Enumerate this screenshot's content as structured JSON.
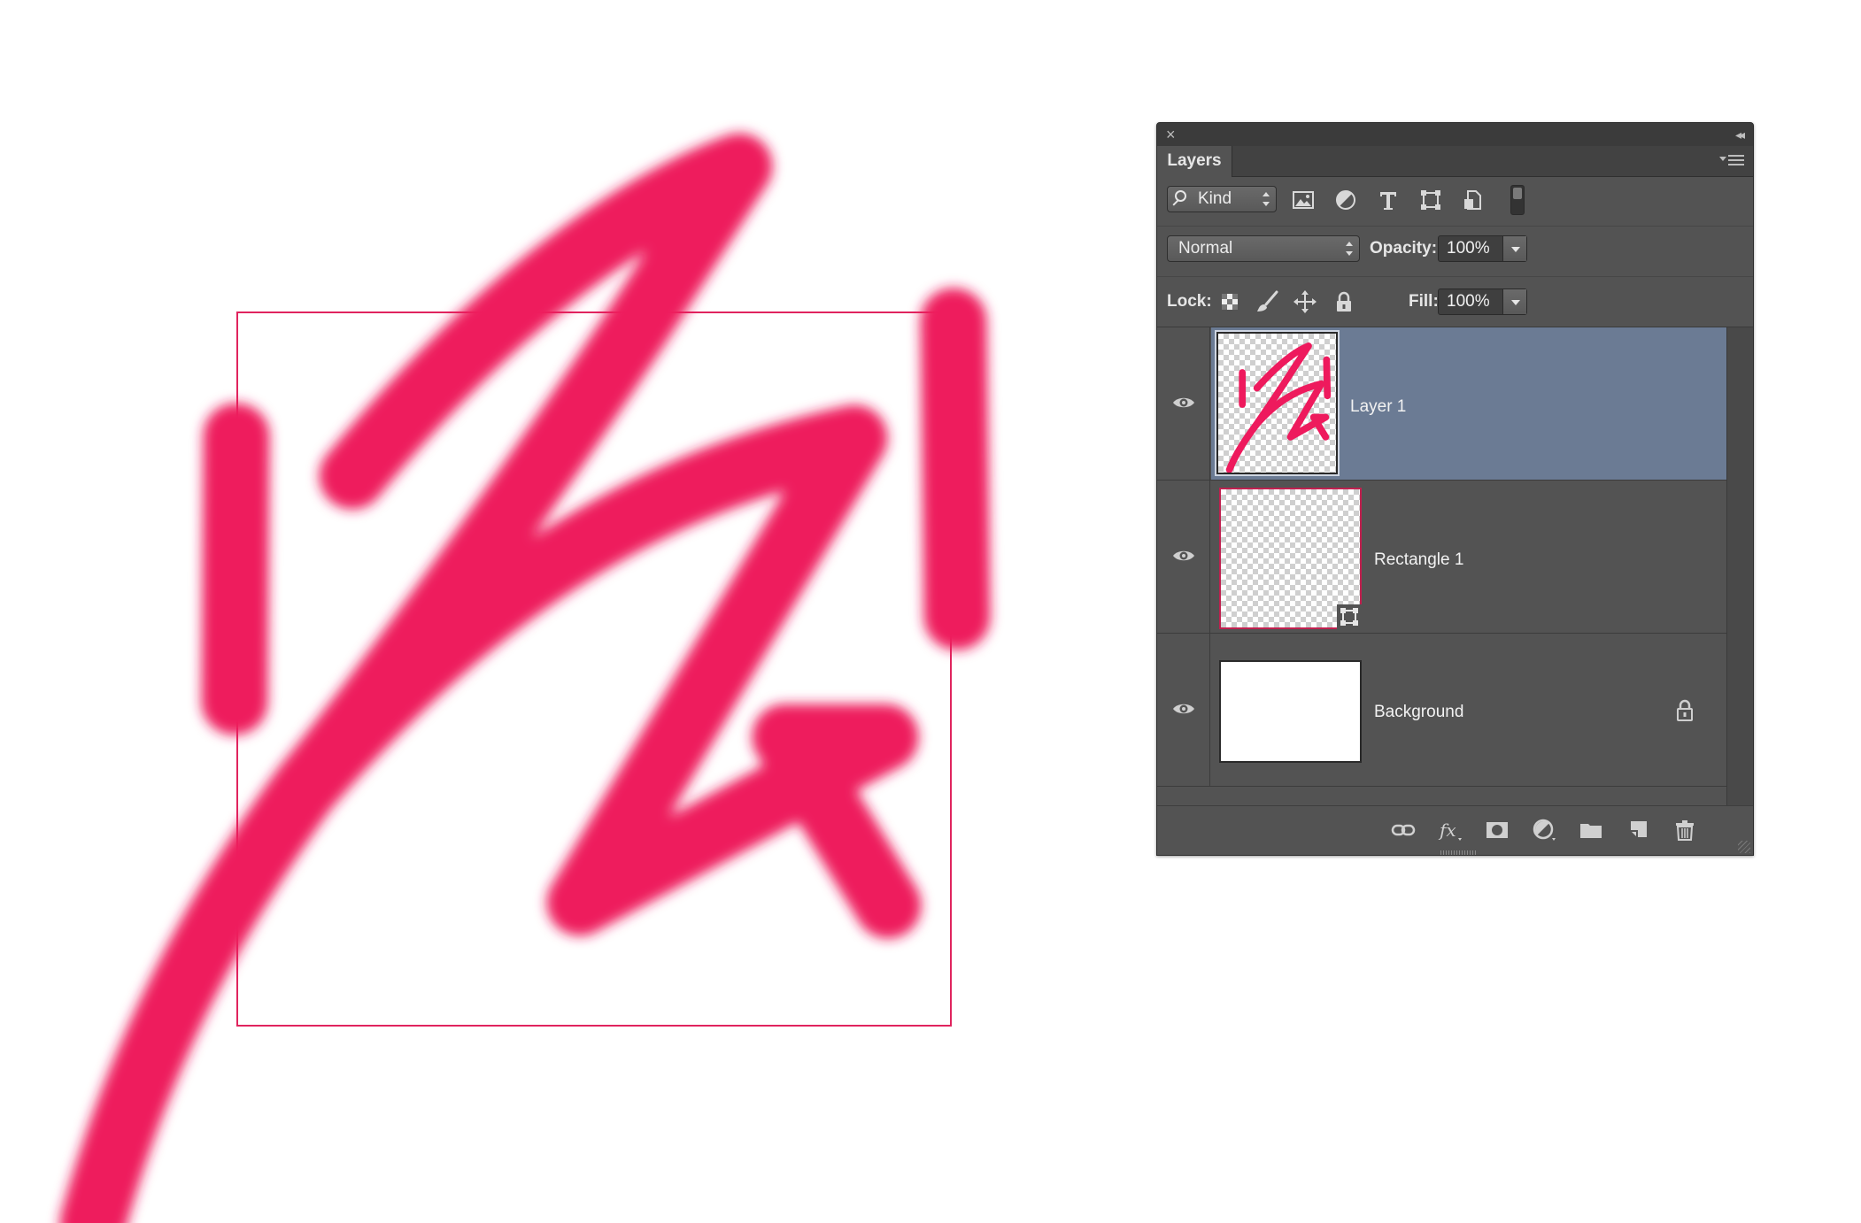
{
  "panel": {
    "tab_label": "Layers",
    "filter": {
      "kind_label": "Kind"
    },
    "blend_mode": "Normal",
    "opacity_label": "Opacity:",
    "opacity_value": "100%",
    "lock_label": "Lock:",
    "fill_label": "Fill:",
    "fill_value": "100%",
    "layers": [
      {
        "name": "Layer 1",
        "selected": true,
        "visible": true
      },
      {
        "name": "Rectangle 1",
        "selected": false,
        "visible": true
      },
      {
        "name": "Background",
        "selected": false,
        "visible": true,
        "locked": true
      }
    ],
    "bottom_icons": [
      "link-icon",
      "fx-icon",
      "mask-icon",
      "adjustment-icon",
      "folder-icon",
      "new-layer-icon",
      "trash-icon"
    ]
  },
  "colors": {
    "stroke": "#ee1a5d",
    "rect_outline": "#e0245e",
    "panel_bg": "#535353",
    "selected_row": "#6b7b94"
  }
}
